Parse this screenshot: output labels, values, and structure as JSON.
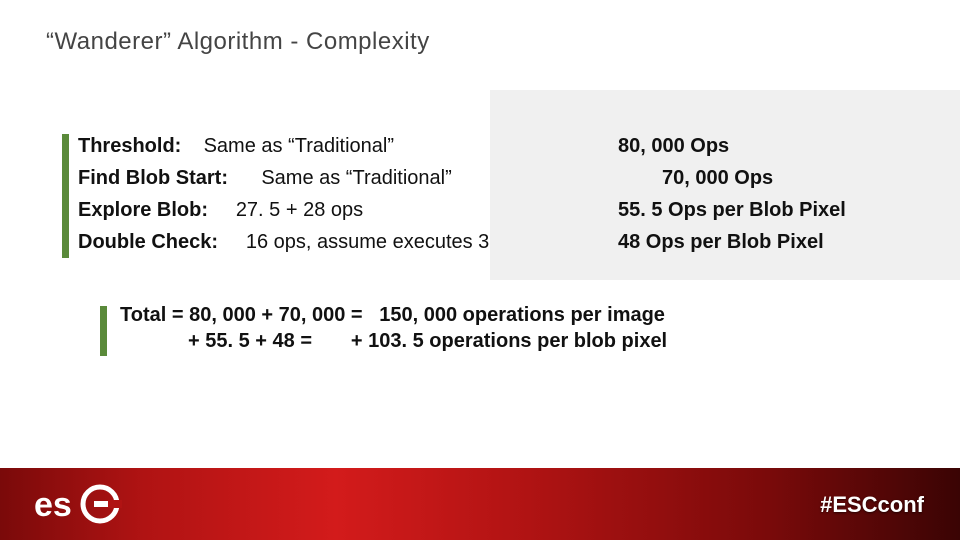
{
  "title_quote": "“Wanderer”",
  "title_rest": "Algorithm - Complexity",
  "rows": [
    {
      "label": "Threshold:",
      "desc": "Same as “Traditional”",
      "ops": "80, 000 Ops"
    },
    {
      "label": "Find Blob Start:",
      "desc": "Same as “Traditional”",
      "ops": "70, 000 Ops"
    },
    {
      "label": "Explore Blob:",
      "desc": "27. 5 + 28 ops",
      "ops": "55. 5 Ops per Blob Pixel"
    },
    {
      "label": "Double Check:",
      "desc": "16 ops, assume executes 3",
      "ops": "48 Ops per Blob Pixel"
    }
  ],
  "total_line1_lhs": "Total = 80, 000 + 70, 000 =",
  "total_line1_rhs": "150, 000 operations per image",
  "total_line2_lhs": "+ 55. 5 + 48 =",
  "total_line2_rhs": "+ 103. 5 operations per blob pixel",
  "hashtag": "#ESCconf",
  "logo_text": "esc",
  "colors": {
    "accent_green": "#5a8a3a",
    "footer_red": "#b01313"
  }
}
